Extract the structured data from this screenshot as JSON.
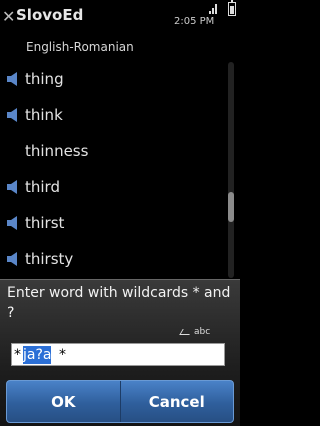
{
  "titlebar": {
    "app_title": "SlovoEd",
    "close_glyph": "✕",
    "time": "2:05 PM",
    "signal_icon": "signal-strength-icon",
    "battery_icon": "battery-icon",
    "battery_level": 0.8
  },
  "subtitle": "English-Romanian",
  "word_list": {
    "items": [
      {
        "word": "thing",
        "has_audio": true
      },
      {
        "word": "think",
        "has_audio": true
      },
      {
        "word": "thinness",
        "has_audio": false
      },
      {
        "word": "third",
        "has_audio": true
      },
      {
        "word": "thirst",
        "has_audio": true
      },
      {
        "word": "thirsty",
        "has_audio": true
      }
    ],
    "scroll_position": 0.7
  },
  "dialog": {
    "prompt": "Enter word with wildcards * and ?",
    "input_mode": "abc",
    "input": {
      "prefix": "*",
      "selected": "ja?a",
      "suffix": "*"
    },
    "ok_label": "OK",
    "cancel_label": "Cancel"
  },
  "colors": {
    "selection": "#2b6fd6",
    "button_blue": "#3a6fae",
    "speaker_blue": "#5a86c8"
  }
}
